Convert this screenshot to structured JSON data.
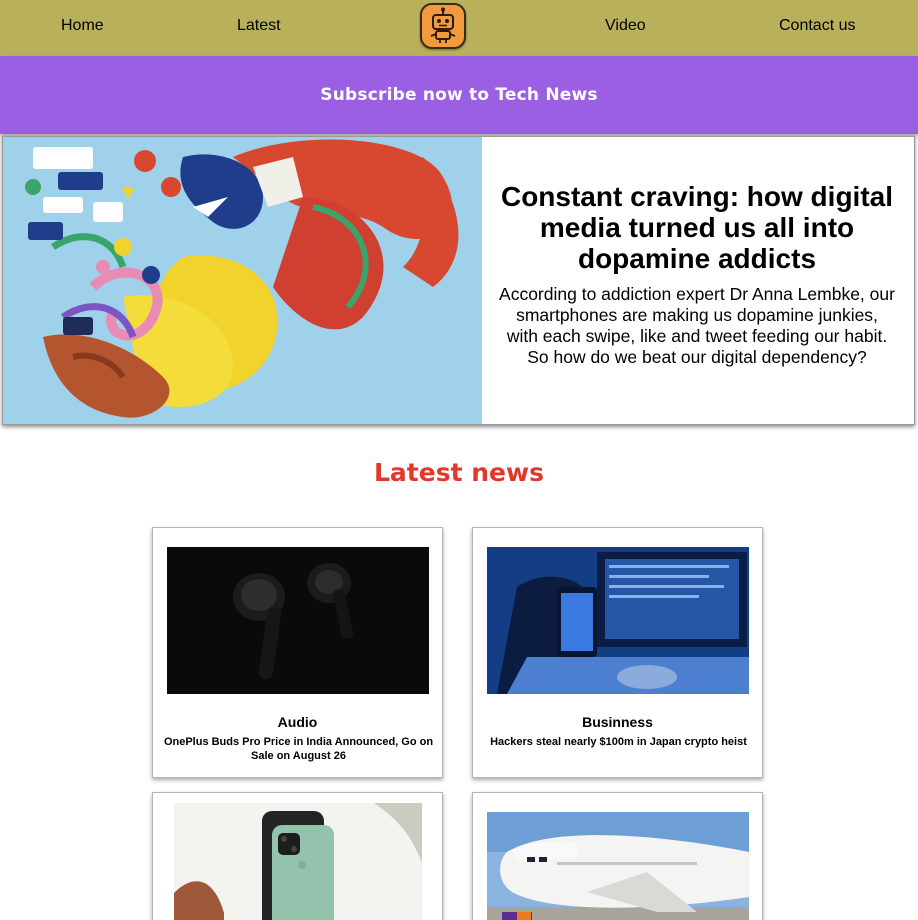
{
  "nav": {
    "home": "Home",
    "latest": "Latest",
    "video": "Video",
    "contact": "Contact us"
  },
  "subscribe": {
    "text": "Subscribe now to Tech News"
  },
  "hero": {
    "title": "Constant craving: how digital media turned us all into dopamine addicts",
    "body": "According to addiction expert Dr Anna Lembke, our smartphones are making us dopamine junkies, with each swipe, like and tweet feeding our habit. So how do we beat our digital dependency?"
  },
  "latest": {
    "heading": "Latest news",
    "cards": [
      {
        "category": "Audio",
        "headline": "OnePlus Buds Pro Price in India Announced, Go on Sale on August 26"
      },
      {
        "category": "Businness",
        "headline": "Hackers steal nearly $100m in Japan crypto heist"
      },
      {
        "category": "",
        "headline": ""
      },
      {
        "category": "",
        "headline": ""
      }
    ]
  },
  "colors": {
    "nav_bg": "#b8b05b",
    "subscribe_bg": "#9b5fe3",
    "latest_heading": "#e0392b",
    "logo_bg": "#f19a3e"
  },
  "icons": {
    "logo": "robot-icon"
  }
}
